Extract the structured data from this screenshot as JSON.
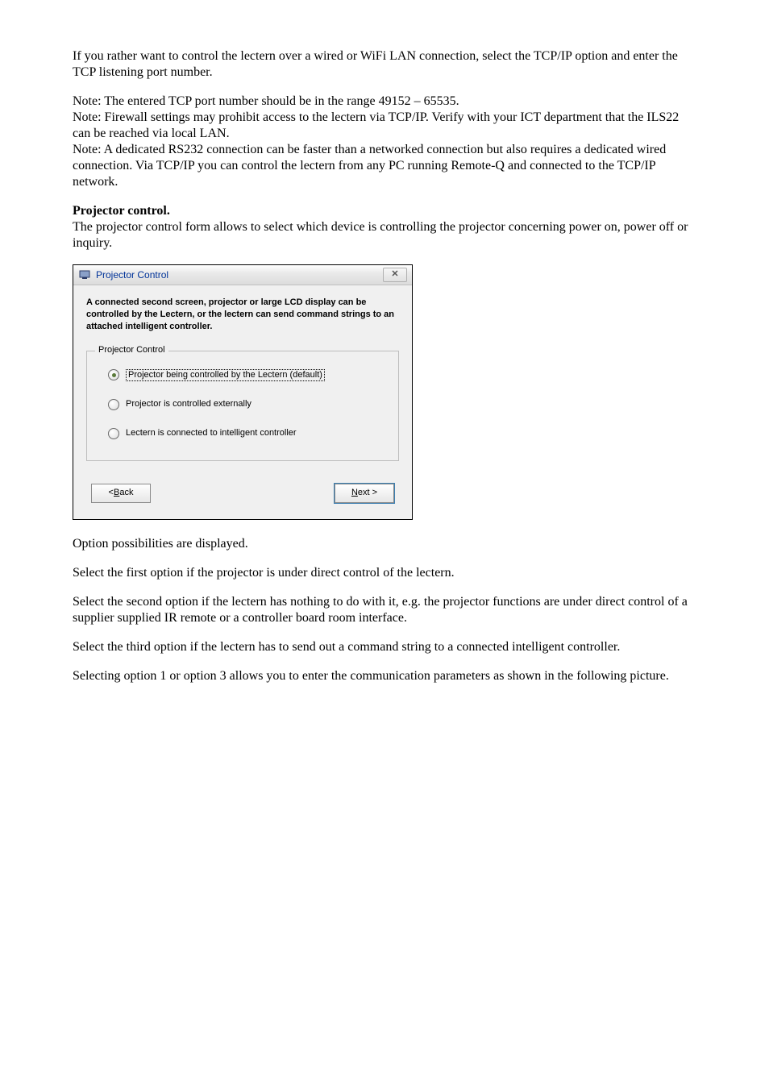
{
  "doc": {
    "p1": "If you rather want to control the lectern over a wired or WiFi LAN connection, select the TCP/IP option and enter the TCP listening port number.",
    "note1": "Note: The entered TCP port number should be in the range 49152 – 65535.",
    "note2": "Note: Firewall settings may prohibit access to the lectern via TCP/IP. Verify with your ICT department that the ILS22 can be reached via local LAN.",
    "note3": "Note: A dedicated RS232 connection can be faster than a networked connection but also requires a dedicated wired connection. Via TCP/IP you can control the lectern from any PC running Remote-Q and connected to the TCP/IP network.",
    "h_projector": "Projector control.",
    "h_projector_body": "The projector control form allows to select which device is controlling the projector concerning power on, power off or inquiry.",
    "p_after1": "Option possibilities are displayed.",
    "p_after2": "Select the first option if the projector is under direct control of the lectern.",
    "p_after3": "Select the second option if the lectern has nothing to do with it, e.g. the projector functions are under direct control of a supplier supplied IR remote or a controller board room interface.",
    "p_after4": "Select the third option if the lectern has to send out a command string to a connected intelligent controller.",
    "p_after5": "Selecting option 1 or option 3 allows you to enter the communication parameters as shown in the following picture."
  },
  "dialog": {
    "title": "Projector Control",
    "close": "✕",
    "description": "A connected second screen, projector or large LCD display can be controlled by the Lectern, or the lectern can send command strings to an attached intelligent controller.",
    "group_legend": "Projector Control",
    "options": {
      "opt1": "Projector being controlled by the Lectern (default)",
      "opt2": "Projector is controlled externally",
      "opt3": "Lectern is connected to intelligent controller"
    },
    "back_u": "B",
    "back_rest": "ack",
    "back_prefix": "< ",
    "next_u": "N",
    "next_rest": "ext >"
  }
}
